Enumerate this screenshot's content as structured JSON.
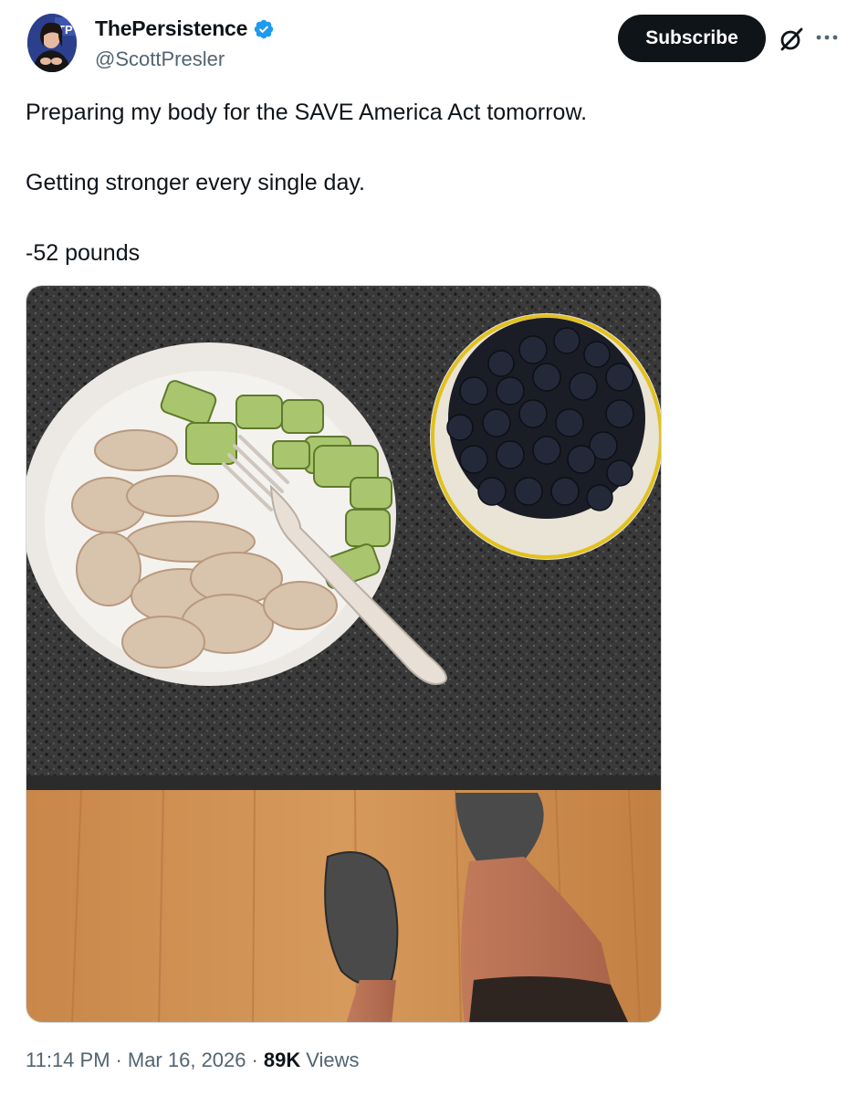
{
  "author": {
    "display_name": "ThePersistence",
    "handle": "@ScottPresler",
    "verified": true,
    "avatar_icon": "avatar-photo",
    "avatar_logo_text": "TP"
  },
  "actions": {
    "subscribe_label": "Subscribe",
    "grok_icon": "circle-slash-icon",
    "more_icon": "ellipsis-icon"
  },
  "tweet": {
    "paragraphs": [
      "Preparing my body for the SAVE America Act tomorrow.",
      "Getting stronger every single day.",
      "-52 pounds"
    ],
    "media_description_icon": "photo"
  },
  "meta": {
    "time": "11:14 PM",
    "separator": "·",
    "date": "Mar 16, 2026",
    "views_count": "89K",
    "views_label": "Views"
  },
  "colors": {
    "verified_blue": "#1d9bf0",
    "text_primary": "#0f1419",
    "text_secondary": "#536471",
    "button_bg": "#0f1419"
  }
}
